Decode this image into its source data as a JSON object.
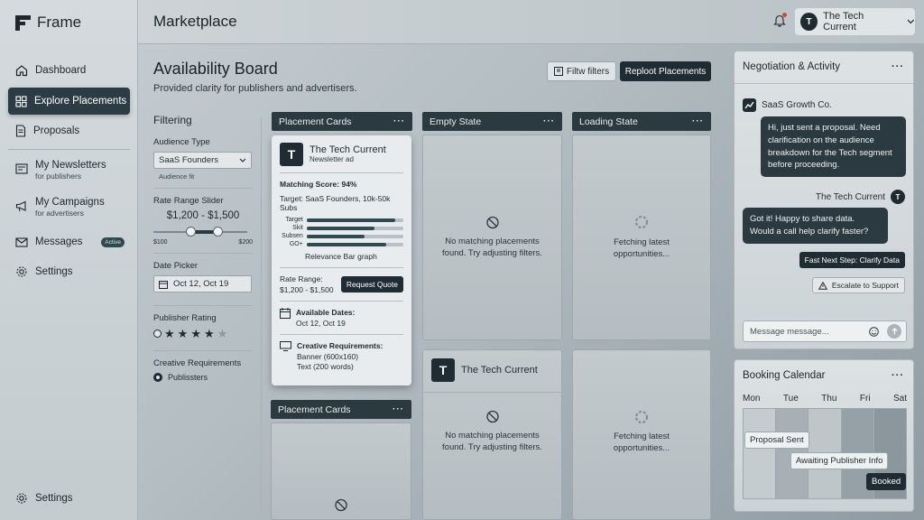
{
  "app": {
    "name": "Frame"
  },
  "sidebar": {
    "items": [
      {
        "label": "Dashboard",
        "icon": "home-icon"
      },
      {
        "label": "Explore Placements",
        "icon": "grid-icon",
        "active": true
      },
      {
        "label": "Proposals",
        "icon": "document-icon"
      },
      {
        "label": "My Newsletters",
        "sub": "for publishers",
        "icon": "newsletter-icon"
      },
      {
        "label": "My Campaigns",
        "sub": "for advertisers",
        "icon": "megaphone-icon"
      },
      {
        "label": "Messages",
        "badge": "Active",
        "icon": "mail-icon"
      },
      {
        "label": "Settings",
        "icon": "gear-icon"
      }
    ],
    "footer_settings": "Settings"
  },
  "topbar": {
    "title": "Marketplace",
    "user_name": "The Tech Current",
    "user_initial": "T"
  },
  "board": {
    "title": "Availability Board",
    "subtitle": "Provided clarity for publishers and advertisers.",
    "filter_button": "Filtw filters",
    "reload_button": "Reploot Placements"
  },
  "filters": {
    "title": "Filtering",
    "audience_label": "Audience Type",
    "audience_value": "SaaS Founders",
    "audience_hint": "Audience fit",
    "range_label": "Rate Range Slider",
    "range_value": "$1,200 - $1,500",
    "range_min": "$100",
    "range_max": "$200",
    "date_label": "Date Picker",
    "date_value": "Oct 12, Oct 19",
    "rating_label": "Publisher Rating",
    "rating": 4,
    "rating_max": 5,
    "creative_label": "Creative Requirements",
    "creative_option": "Publissters"
  },
  "columns": {
    "placement": "Placement Cards",
    "empty": "Empty State",
    "loading": "Loading State",
    "placement2": "Placement Cards"
  },
  "card": {
    "name": "The Tech Current",
    "type": "Newsletter ad",
    "matching": "Matching Score: 94%",
    "target": "Target: SaaS Founders, 10k-50k Subs",
    "bars": [
      {
        "label": "Target",
        "value": 0.92
      },
      {
        "label": "Skit",
        "value": 0.7
      },
      {
        "label": "Subsen",
        "value": 0.6
      },
      {
        "label": "GO+",
        "value": 0.82
      }
    ],
    "bars_caption": "Relevance Bar graph",
    "rate_label": "Rate Range:",
    "rate_value": "$1,200 - $1,500",
    "quote_button": "Request Quote",
    "dates_label": "Available Dates:",
    "dates_value": "Oct 12, Oct 19",
    "creative_label": "Creative Requirements:",
    "creative_1": "Banner (600x160)",
    "creative_2": "Text (200 words)"
  },
  "empty_state": {
    "line1": "No matching placements",
    "line2": "found. Try adjusting filters."
  },
  "loading_state": {
    "line1": "Fetching latest",
    "line2": "opportunities..."
  },
  "second_card": {
    "name": "The Tech Current"
  },
  "negotiation": {
    "title": "Negotiation & Activity",
    "sender": "SaaS Growth Co.",
    "msg1": "Hi, just sent a proposal. Need clarification on the audience breakdown for the Tech segment before proceeding.",
    "reply_name": "The Tech Current",
    "msg2": "Got it! Happy to share data. Would a call help clarify faster?",
    "next_step": "Fast Next Step: Clarify Data",
    "escalate": "Escalate to Support",
    "input_placeholder": "Message message..."
  },
  "calendar": {
    "title": "Booking Calendar",
    "days": [
      "Mon",
      "Tue",
      "Thu",
      "Fri",
      "Sat"
    ],
    "tags": {
      "sent": "Proposal Sent",
      "awaiting": "Awaiting Publisher Info",
      "booked": "Booked"
    }
  }
}
